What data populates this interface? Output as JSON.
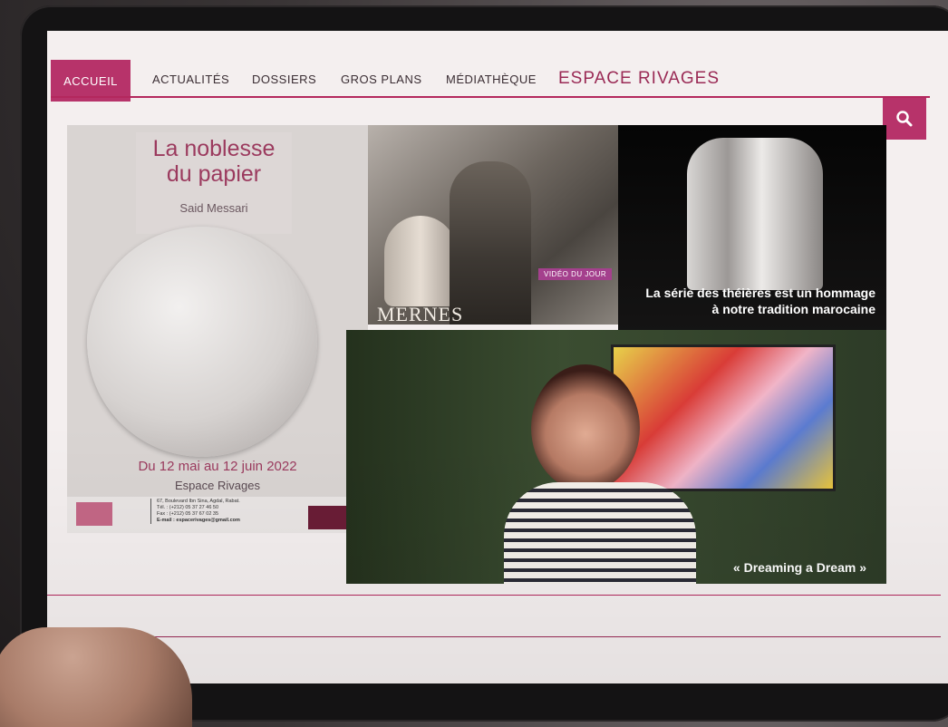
{
  "nav": {
    "items": [
      {
        "label": "ACCUEIL",
        "active": true
      },
      {
        "label": "ACTUALITÉS"
      },
      {
        "label": "DOSSIERS"
      },
      {
        "label": "GROS PLANS"
      },
      {
        "label": "MÉDIATHÈQUE"
      }
    ],
    "brand": "ESPACE RIVAGES",
    "search_icon": "search-icon"
  },
  "poster": {
    "title_line1": "La noblesse",
    "title_line2": "du papier",
    "author": "Said Messari",
    "dates": "Du 12 mai au 12 juin 2022",
    "venue": "Espace Rivages",
    "footer": {
      "address": "67, Boulevard Ibn Sina, Agdal, Rabat.",
      "tel": "Tél. : (+212) 05 37 27 46 50",
      "fax": "Fax : (+212) 05 37 67 02 35",
      "email": "E-mail : espacerivages@gmail.com"
    }
  },
  "mernes": {
    "badge": "VIDÉO DU JOUR",
    "word": "MERNES"
  },
  "tea": {
    "caption_line1": "La série des théières est un hommage",
    "caption_line2": "à notre tradition marocaine"
  },
  "dream": {
    "caption": "« Dreaming a Dream »"
  },
  "colors": {
    "accent": "#b7336a",
    "brand": "#9a2a55"
  }
}
